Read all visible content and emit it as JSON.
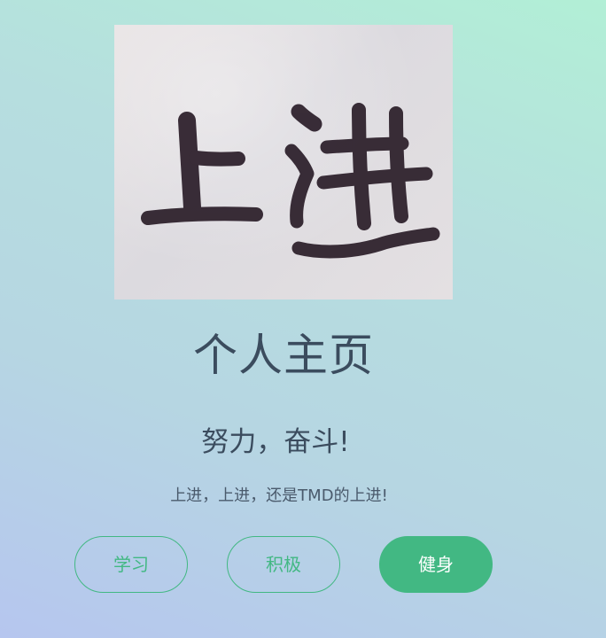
{
  "hero_image": {
    "calligraphy_text": "上进",
    "ink_color": "#2c1f2a",
    "paper_color": "#e2dfe2"
  },
  "page_title": "个人主页",
  "subtitle": "努力，奋斗!",
  "tagline": "上进，上进，还是TMD的上进!",
  "buttons": [
    {
      "label": "学习",
      "style": "outline"
    },
    {
      "label": "积极",
      "style": "outline"
    },
    {
      "label": "健身",
      "style": "solid"
    }
  ],
  "colors": {
    "accent": "#42b883",
    "text": "#3b4c5e",
    "background_top": "#b2efd6",
    "background_bottom": "#b6c6ef"
  }
}
